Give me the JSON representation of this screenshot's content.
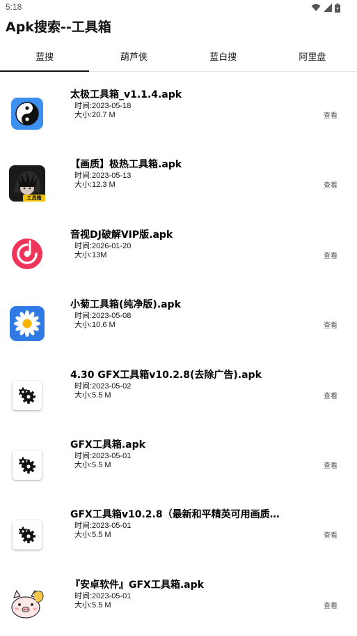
{
  "status_bar": {
    "time": "5:18"
  },
  "app": {
    "title": "Apk搜索--工具箱"
  },
  "tabs": [
    {
      "label": "蓝搜",
      "active": true
    },
    {
      "label": "葫芦侠",
      "active": false
    },
    {
      "label": "蓝白搜",
      "active": false
    },
    {
      "label": "阿里盘",
      "active": false
    }
  ],
  "items": [
    {
      "name": "太极工具箱_v1.1.4.apk",
      "time": "时间:2023-05-18",
      "size": "大小:20.7 M",
      "view": "查看",
      "icon": "taichi-icon"
    },
    {
      "name": "【画质】极热工具箱.apk",
      "time": "时间:2023-05-13",
      "size": "大小:12.3 M",
      "view": "查看",
      "icon": "anime-avatar-icon",
      "icon_badge": "工具箱"
    },
    {
      "name": "音视DJ破解VIP版.apk",
      "time": "时间:2026-01-20",
      "size": "大小:13M",
      "view": "查看",
      "icon": "music-disc-icon"
    },
    {
      "name": "小菊工具箱(纯净版).apk",
      "time": "时间:2023-05-08",
      "size": "大小:10.6 M",
      "view": "查看",
      "icon": "daisy-icon"
    },
    {
      "name": "4.30 GFX工具箱v10.2.8(去除广告).apk",
      "time": "时间:2023-05-02",
      "size": "大小:5.5 M",
      "view": "查看",
      "icon": "gears-icon"
    },
    {
      "name": "GFX工具箱.apk",
      "time": "时间:2023-05-01",
      "size": "大小:5.5 M",
      "view": "查看",
      "icon": "gears-icon"
    },
    {
      "name": "GFX工具箱v10.2.8（最新和平精英可用画质…",
      "time": "时间:2023-05-01",
      "size": "大小:5.5 M",
      "view": "查看",
      "icon": "gears-icon"
    },
    {
      "name": "『安卓软件』GFX工具箱.apk",
      "time": "时间:2023-05-01",
      "size": "大小:5.5 M",
      "view": "查看",
      "icon": "pig-mascot-icon"
    }
  ],
  "colors": {
    "taichi_bg": "#3d8ff0",
    "music_red": "#f0345a",
    "daisy_bg": "#2f7ae5",
    "text_secondary": "#555555"
  }
}
